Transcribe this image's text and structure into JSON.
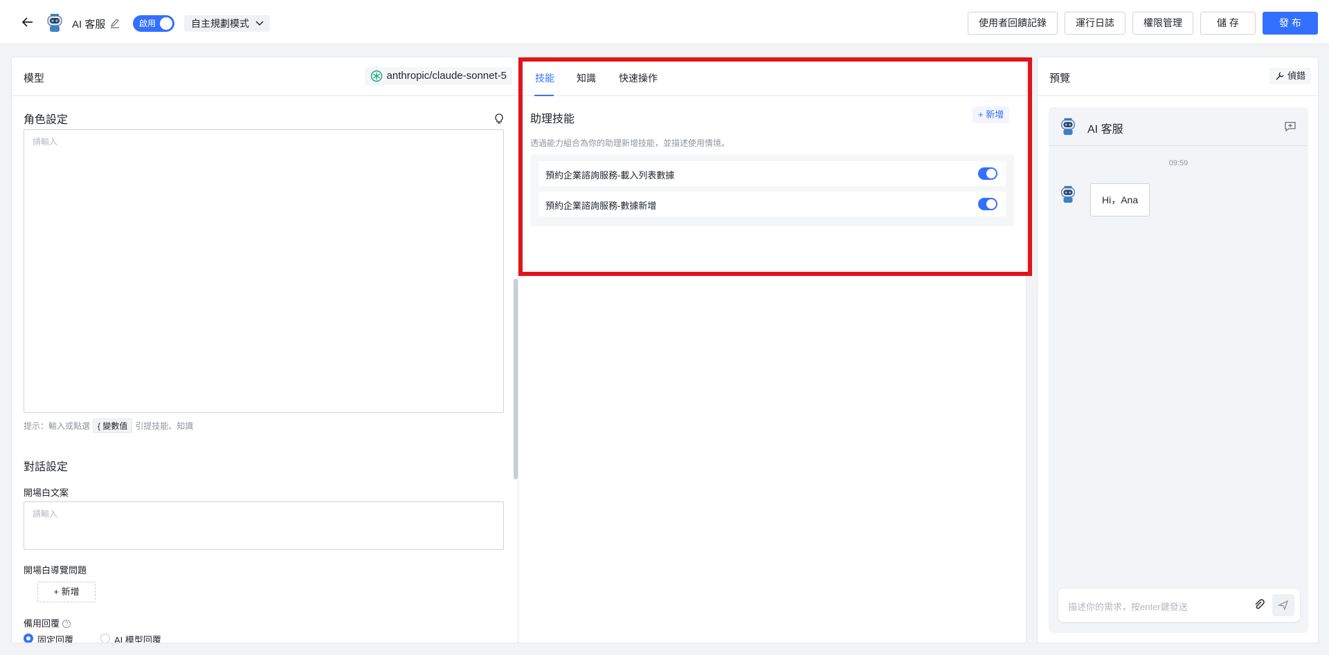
{
  "header": {
    "app_name": "AI 客服",
    "enabled_label": "啟用",
    "mode": "自主規劃模式",
    "buttons": {
      "feedback": "使用者回饋記錄",
      "logs": "運行日誌",
      "permissions": "權限管理",
      "save": "儲 存",
      "publish": "發 布"
    }
  },
  "left": {
    "title": "模型",
    "model": "anthropic/claude-sonnet-5",
    "role_title": "角色設定",
    "role_placeholder": "請輸入",
    "hint_prefix": "提示：輸入或點選",
    "hint_chip": "{ 變數值",
    "hint_suffix": "引提技能、知識",
    "dialog_title": "對話設定",
    "opening_label": "開場白文案",
    "opening_placeholder": "請輸入",
    "guide_label": "開場白導覽問題",
    "add_label": "+ 新增",
    "fallback_label": "備用回覆",
    "radio_fixed": "固定回覆",
    "radio_ai": "AI 模型回覆"
  },
  "middle": {
    "tabs": [
      "技能",
      "知識",
      "快速操作"
    ],
    "section_title": "助理技能",
    "add_label": "+ 新增",
    "description": "透過能力組合為你的助理新增技能，並描述使用情境。",
    "skills": [
      {
        "name": "預約企業諮詢服務-載入列表數據",
        "enabled": true
      },
      {
        "name": "預約企業諮詢服務-數據新增",
        "enabled": true
      }
    ]
  },
  "right": {
    "title": "預覽",
    "debug_label": "偵錯",
    "bot_name": "AI 客服",
    "time": "09:59",
    "greeting": "Hi，Ana",
    "input_placeholder": "描述你的需求，按enter鍵發送"
  },
  "colors": {
    "accent": "#3370ff",
    "highlight": "#e0151b"
  }
}
